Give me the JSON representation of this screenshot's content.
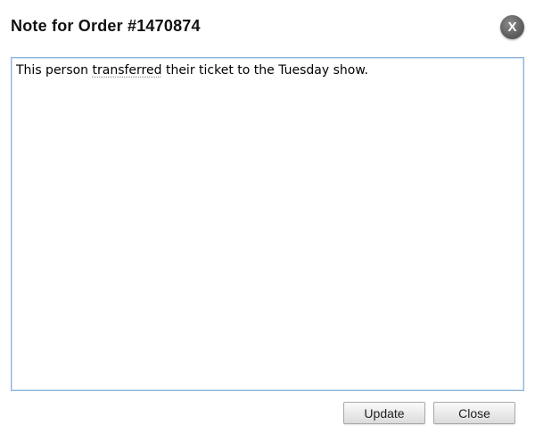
{
  "dialog": {
    "title": "Note for Order #1470874",
    "close_icon_label": "X",
    "note": {
      "before": "This person ",
      "misspelled_word": "transferred",
      "after": " their ticket to the Tuesday show."
    },
    "buttons": {
      "update_label": "Update",
      "close_label": "Close"
    }
  },
  "colors": {
    "textarea_border": "#8fb3d9",
    "close_icon_bg": "#5e5e5e",
    "button_border": "#a9a9a9"
  }
}
